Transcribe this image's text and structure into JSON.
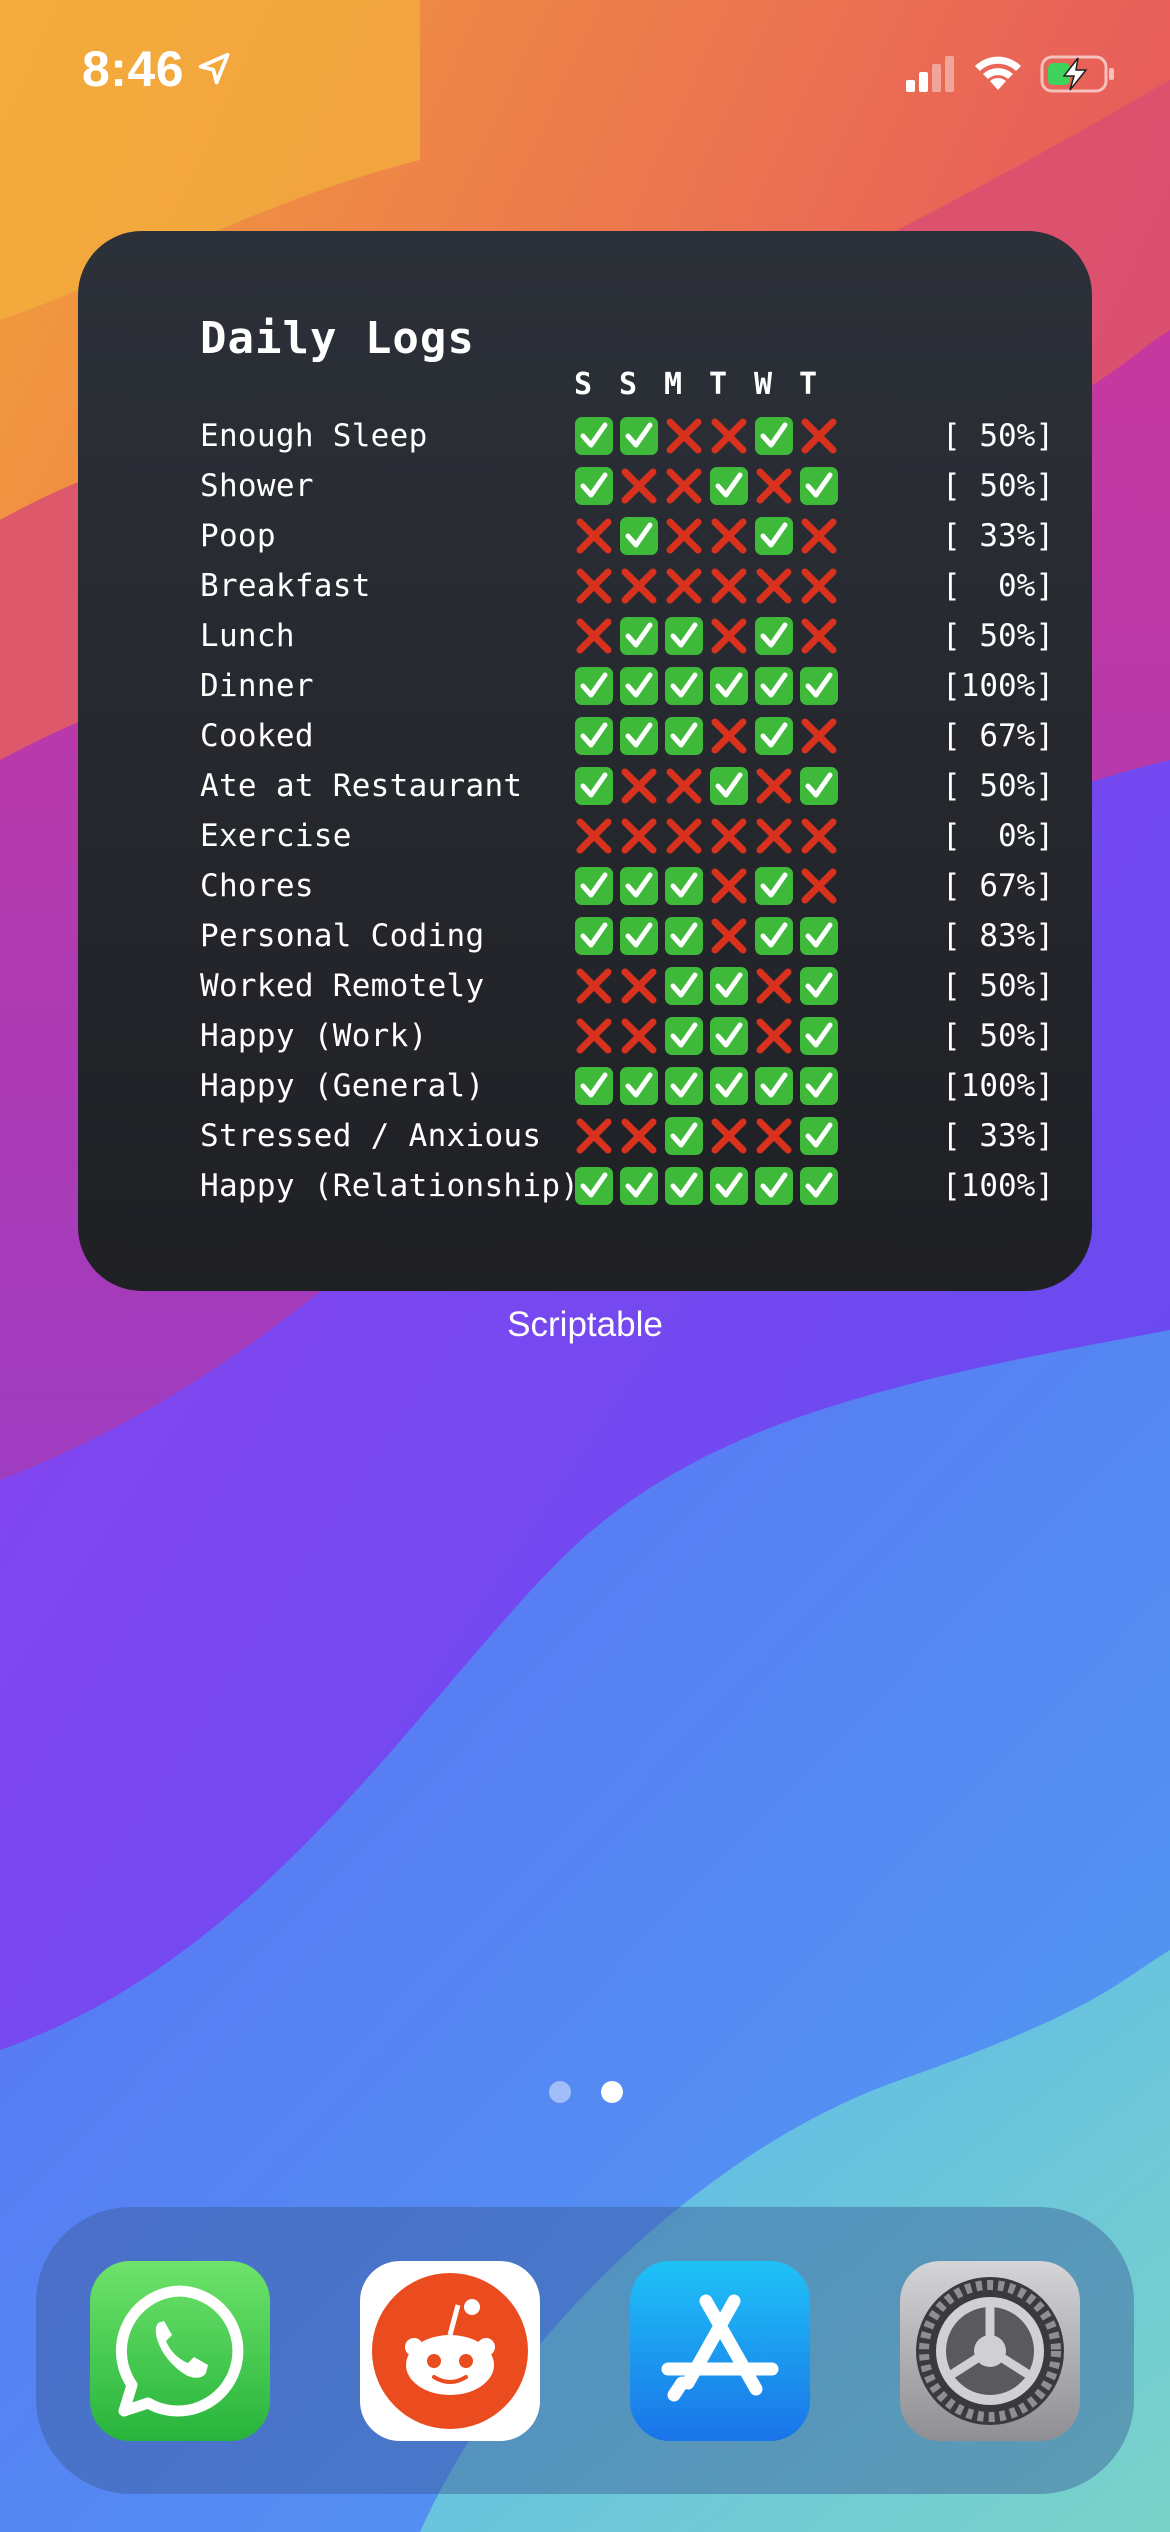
{
  "status_bar": {
    "time": "8:46",
    "icons": [
      "location-arrow-icon",
      "cellular-signal-icon",
      "wifi-icon",
      "battery-charging-icon"
    ]
  },
  "widget": {
    "title": "Daily Logs",
    "days": [
      "S",
      "S",
      "M",
      "T",
      "W",
      "T"
    ],
    "rows": [
      {
        "label": "Enough Sleep",
        "marks": [
          1,
          1,
          0,
          0,
          1,
          0
        ],
        "percent": "[ 50%]"
      },
      {
        "label": "Shower",
        "marks": [
          1,
          0,
          0,
          1,
          0,
          1
        ],
        "percent": "[ 50%]"
      },
      {
        "label": "Poop",
        "marks": [
          0,
          1,
          0,
          0,
          1,
          0
        ],
        "percent": "[ 33%]"
      },
      {
        "label": "Breakfast",
        "marks": [
          0,
          0,
          0,
          0,
          0,
          0
        ],
        "percent": "[  0%]"
      },
      {
        "label": "Lunch",
        "marks": [
          0,
          1,
          1,
          0,
          1,
          0
        ],
        "percent": "[ 50%]"
      },
      {
        "label": "Dinner",
        "marks": [
          1,
          1,
          1,
          1,
          1,
          1
        ],
        "percent": "[100%]"
      },
      {
        "label": "Cooked",
        "marks": [
          1,
          1,
          1,
          0,
          1,
          0
        ],
        "percent": "[ 67%]"
      },
      {
        "label": "Ate at Restaurant",
        "marks": [
          1,
          0,
          0,
          1,
          0,
          1
        ],
        "percent": "[ 50%]"
      },
      {
        "label": "Exercise",
        "marks": [
          0,
          0,
          0,
          0,
          0,
          0
        ],
        "percent": "[  0%]"
      },
      {
        "label": "Chores",
        "marks": [
          1,
          1,
          1,
          0,
          1,
          0
        ],
        "percent": "[ 67%]"
      },
      {
        "label": "Personal Coding",
        "marks": [
          1,
          1,
          1,
          0,
          1,
          1
        ],
        "percent": "[ 83%]"
      },
      {
        "label": "Worked Remotely",
        "marks": [
          0,
          0,
          1,
          1,
          0,
          1
        ],
        "percent": "[ 50%]"
      },
      {
        "label": "Happy (Work)",
        "marks": [
          0,
          0,
          1,
          1,
          0,
          1
        ],
        "percent": "[ 50%]"
      },
      {
        "label": "Happy (General)",
        "marks": [
          1,
          1,
          1,
          1,
          1,
          1
        ],
        "percent": "[100%]"
      },
      {
        "label": "Stressed / Anxious",
        "marks": [
          0,
          0,
          1,
          0,
          0,
          1
        ],
        "percent": "[ 33%]"
      },
      {
        "label": "Happy (Relationship)",
        "marks": [
          1,
          1,
          1,
          1,
          1,
          1
        ],
        "percent": "[100%]"
      }
    ],
    "caption": "Scriptable",
    "colors": {
      "check": "#3fb93a",
      "cross": "#d8321f",
      "background": "#25272c"
    }
  },
  "home": {
    "page_count": 2,
    "current_page": 2
  },
  "dock": {
    "apps": [
      {
        "name": "WhatsApp",
        "icon": "whatsapp-icon"
      },
      {
        "name": "Reddit",
        "icon": "reddit-icon"
      },
      {
        "name": "App Store",
        "icon": "app-store-icon"
      },
      {
        "name": "Settings",
        "icon": "settings-gear-icon"
      }
    ]
  }
}
